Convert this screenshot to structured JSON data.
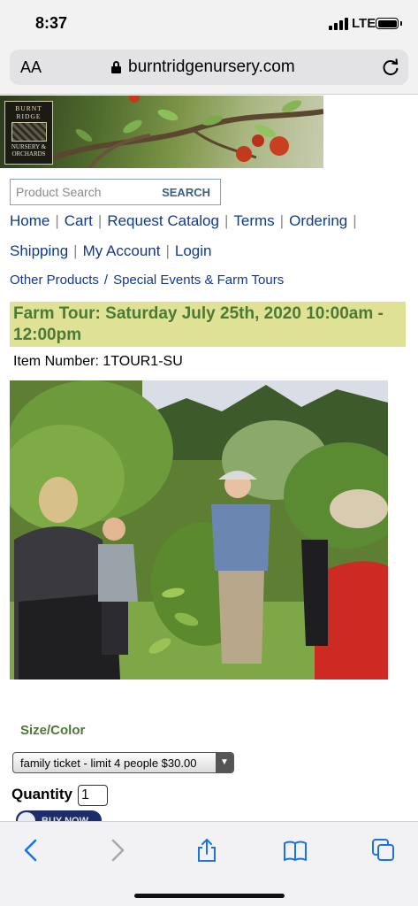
{
  "status": {
    "time": "8:37",
    "network": "LTE"
  },
  "browser": {
    "text_size_label": "AA",
    "url": "burntridgenursery.com"
  },
  "header": {
    "logo_top": "BURNT RIDGE",
    "logo_bottom": "NURSERY & ORCHARDS"
  },
  "search": {
    "placeholder": "Product Search",
    "button_label": "SEARCH"
  },
  "nav": {
    "row1": [
      "Home",
      "Cart",
      "Request Catalog",
      "Terms",
      "Ordering"
    ],
    "row2": [
      "Shipping",
      "My Account",
      "Login"
    ]
  },
  "breadcrumb": [
    "Other Products",
    "Special Events & Farm Tours"
  ],
  "product": {
    "title": "Farm Tour: Saturday July 25th, 2020 10:00am - 12:00pm",
    "item_number": "Item Number: 1TOUR1-SU"
  },
  "options": {
    "size_label": "Size/Color",
    "size_selected": "family ticket - limit 4 people $30.00",
    "quantity_label": "Quantity",
    "quantity_value": "1",
    "buy_label": "BUY NOW"
  },
  "icons": {
    "back": "chevron-left-icon",
    "forward": "chevron-right-icon",
    "share": "share-icon",
    "bookmarks": "book-icon",
    "tabs": "tabs-icon"
  },
  "colors": {
    "link": "#123a8a",
    "title_green": "#4c7a36",
    "title_band": "#dfe294",
    "ios_blue": "#1a73e8"
  }
}
